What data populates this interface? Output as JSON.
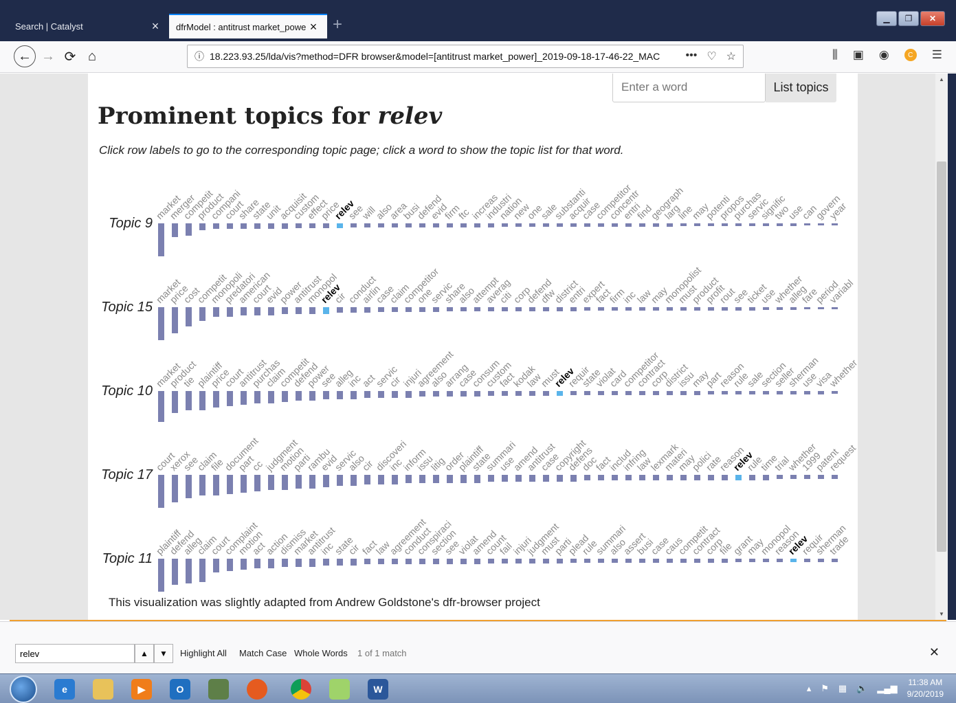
{
  "browser": {
    "tabs": [
      {
        "title": "Search | Catalyst",
        "active": false
      },
      {
        "title": "dfrModel : antitrust market_power",
        "active": true
      }
    ],
    "url": "18.223.93.25/lda/vis?method=DFR browser&model=[antitrust market_power]_2019-09-18-17-46-22_MAC"
  },
  "page": {
    "word_input_placeholder": "Enter a word",
    "list_button": "List topics",
    "title_prefix": "Prominent topics for ",
    "title_word": "relev",
    "instructions": "Click row labels to go to the corresponding topic page; click a word to show the topic list for that word.",
    "credit": "This visualization was slightly adapted from Andrew Goldstone's dfr-browser project"
  },
  "chart_data": {
    "type": "bar",
    "highlight_word": "relev",
    "colors": {
      "bar": "#7b80b0",
      "highlight": "#5ab4ea"
    },
    "rows": [
      {
        "label": "Topic 9",
        "words": [
          "market",
          "merger",
          "competit",
          "product",
          "compani",
          "court",
          "share",
          "state",
          "unit",
          "acquisit",
          "custom",
          "effect",
          "price",
          "relev",
          "see",
          "will",
          "also",
          "area",
          "busi",
          "defend",
          "evid",
          "firm",
          "ftc",
          "increas",
          "industri",
          "nation",
          "new",
          "one",
          "sale",
          "substanti",
          "acquir",
          "case",
          "competitor",
          "concentr",
          "entri",
          "find",
          "geograph",
          "larg",
          "line",
          "may",
          "potenti",
          "propos",
          "purchas",
          "servic",
          "signific",
          "two",
          "use",
          "can",
          "govern",
          "year"
        ],
        "weights": [
          48,
          20,
          18,
          10,
          8,
          8,
          8,
          8,
          8,
          8,
          7,
          7,
          7,
          7,
          6,
          6,
          6,
          6,
          6,
          6,
          6,
          6,
          6,
          6,
          6,
          5,
          5,
          5,
          5,
          5,
          5,
          5,
          5,
          5,
          5,
          5,
          5,
          5,
          4,
          4,
          4,
          4,
          4,
          4,
          4,
          4,
          4,
          3,
          3,
          3
        ]
      },
      {
        "label": "Topic 15",
        "words": [
          "market",
          "price",
          "cost",
          "competit",
          "monopoli",
          "predatori",
          "american",
          "court",
          "evid",
          "power",
          "antitrust",
          "monopol",
          "relev",
          "cir",
          "conduct",
          "airlin",
          "case",
          "claim",
          "competitor",
          "one",
          "servic",
          "share",
          "also",
          "attempt",
          "averag",
          "citi",
          "corp",
          "defend",
          "dfw",
          "district",
          "entri",
          "expert",
          "fact",
          "firm",
          "inc",
          "law",
          "may",
          "monopolist",
          "must",
          "product",
          "profit",
          "rout",
          "see",
          "ticket",
          "use",
          "whether",
          "alleg",
          "fare",
          "period",
          "variabl"
        ],
        "weights": [
          48,
          38,
          28,
          20,
          14,
          14,
          12,
          12,
          12,
          10,
          10,
          10,
          10,
          8,
          8,
          8,
          7,
          7,
          7,
          7,
          7,
          6,
          6,
          6,
          6,
          6,
          6,
          6,
          6,
          6,
          6,
          5,
          5,
          5,
          5,
          5,
          5,
          5,
          5,
          5,
          5,
          5,
          5,
          5,
          4,
          4,
          4,
          3,
          3,
          3
        ]
      },
      {
        "label": "Topic 10",
        "words": [
          "market",
          "product",
          "tie",
          "plaintiff",
          "price",
          "court",
          "antitrust",
          "purchas",
          "claim",
          "competit",
          "defend",
          "power",
          "see",
          "alleg",
          "inc",
          "act",
          "servic",
          "cir",
          "injuri",
          "agreement",
          "also",
          "arrang",
          "case",
          "consum",
          "custom",
          "fact",
          "kodak",
          "law",
          "must",
          "relev",
          "requir",
          "state",
          "violat",
          "card",
          "competitor",
          "contract",
          "corp",
          "district",
          "issu",
          "may",
          "part",
          "reason",
          "rule",
          "sale",
          "section",
          "seller",
          "sherman",
          "use",
          "visa",
          "whether"
        ],
        "weights": [
          45,
          32,
          28,
          28,
          24,
          22,
          20,
          18,
          18,
          16,
          14,
          14,
          12,
          12,
          12,
          10,
          10,
          10,
          10,
          8,
          8,
          8,
          8,
          8,
          7,
          7,
          7,
          7,
          7,
          7,
          6,
          6,
          6,
          6,
          6,
          6,
          6,
          6,
          6,
          6,
          5,
          5,
          5,
          5,
          5,
          5,
          5,
          5,
          5,
          4
        ]
      },
      {
        "label": "Topic 17",
        "words": [
          "court",
          "xerox",
          "see",
          "claim",
          "file",
          "document",
          "part",
          "cc",
          "judgment",
          "motion",
          "parti",
          "rambu",
          "evid",
          "servic",
          "also",
          "cir",
          "discoveri",
          "inc",
          "inform",
          "issu",
          "litig",
          "order",
          "plaintiff",
          "state",
          "summari",
          "use",
          "amend",
          "antitrust",
          "case",
          "copyright",
          "defens",
          "doc",
          "fact",
          "includ",
          "infring",
          "law",
          "lexmark",
          "materi",
          "may",
          "polici",
          "rate",
          "reason",
          "relev",
          "rule",
          "time",
          "trial",
          "whether",
          "1999",
          "patent",
          "request"
        ],
        "weights": [
          48,
          40,
          34,
          30,
          30,
          28,
          26,
          24,
          22,
          22,
          20,
          20,
          18,
          16,
          16,
          14,
          14,
          14,
          12,
          12,
          12,
          12,
          12,
          12,
          10,
          10,
          10,
          10,
          10,
          10,
          10,
          8,
          8,
          8,
          8,
          8,
          8,
          8,
          8,
          8,
          8,
          8,
          8,
          8,
          8,
          6,
          6,
          6,
          6,
          6
        ]
      },
      {
        "label": "Topic 11",
        "words": [
          "plaintiff",
          "defend",
          "alleg",
          "claim",
          "court",
          "complaint",
          "motion",
          "act",
          "action",
          "dismiss",
          "market",
          "antitrust",
          "inc",
          "state",
          "cir",
          "fact",
          "law",
          "agreement",
          "conduct",
          "conspiraci",
          "section",
          "see",
          "violat",
          "amend",
          "count",
          "fail",
          "injuri",
          "judgment",
          "must",
          "parti",
          "plead",
          "rule",
          "summari",
          "also",
          "assert",
          "busi",
          "case",
          "caus",
          "competit",
          "contract",
          "corp",
          "file",
          "grant",
          "may",
          "monopol",
          "reason",
          "relev",
          "requir",
          "sherman",
          "trade"
        ],
        "weights": [
          48,
          38,
          36,
          34,
          20,
          18,
          16,
          14,
          14,
          12,
          12,
          12,
          10,
          10,
          10,
          8,
          8,
          8,
          8,
          8,
          8,
          8,
          8,
          8,
          7,
          7,
          7,
          7,
          7,
          7,
          6,
          6,
          6,
          6,
          6,
          6,
          6,
          6,
          6,
          6,
          6,
          6,
          5,
          5,
          5,
          5,
          5,
          5,
          5,
          5
        ]
      }
    ]
  },
  "findbar": {
    "query": "relev",
    "highlight_all": "Highlight All",
    "match_case": "Match Case",
    "whole_words": "Whole Words",
    "status": "1 of 1 match"
  },
  "taskbar": {
    "time": "11:38 AM",
    "date": "9/20/2019"
  }
}
